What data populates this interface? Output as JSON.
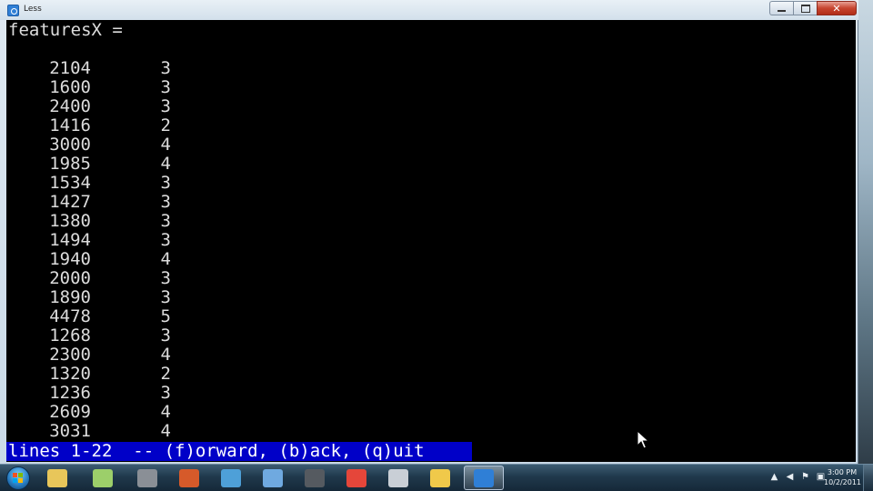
{
  "window": {
    "title": "Less"
  },
  "terminal": {
    "variable_line": "featuresX =",
    "rows": [
      {
        "col1": "2104",
        "col2": "3"
      },
      {
        "col1": "1600",
        "col2": "3"
      },
      {
        "col1": "2400",
        "col2": "3"
      },
      {
        "col1": "1416",
        "col2": "2"
      },
      {
        "col1": "3000",
        "col2": "4"
      },
      {
        "col1": "1985",
        "col2": "4"
      },
      {
        "col1": "1534",
        "col2": "3"
      },
      {
        "col1": "1427",
        "col2": "3"
      },
      {
        "col1": "1380",
        "col2": "3"
      },
      {
        "col1": "1494",
        "col2": "3"
      },
      {
        "col1": "1940",
        "col2": "4"
      },
      {
        "col1": "2000",
        "col2": "3"
      },
      {
        "col1": "1890",
        "col2": "3"
      },
      {
        "col1": "4478",
        "col2": "5"
      },
      {
        "col1": "1268",
        "col2": "3"
      },
      {
        "col1": "2300",
        "col2": "4"
      },
      {
        "col1": "1320",
        "col2": "2"
      },
      {
        "col1": "1236",
        "col2": "3"
      },
      {
        "col1": "2609",
        "col2": "4"
      },
      {
        "col1": "3031",
        "col2": "4"
      }
    ],
    "status": "lines 1-22  -- (f)orward, (b)ack, (q)uit"
  },
  "taskbar": {
    "buttons": [
      {
        "icon": "explorer-icon",
        "color": "#e8c65a",
        "active": false
      },
      {
        "icon": "notes-icon",
        "color": "#9ccf6a",
        "active": false
      },
      {
        "icon": "tools-icon",
        "color": "#8a8f96",
        "active": false
      },
      {
        "icon": "powerpoint-icon",
        "color": "#d65a2a",
        "active": false
      },
      {
        "icon": "remote-icon",
        "color": "#4ea0d8",
        "active": false
      },
      {
        "icon": "network-icon",
        "color": "#6fa9e0",
        "active": false
      },
      {
        "icon": "camera-icon",
        "color": "#555a60",
        "active": false
      },
      {
        "icon": "chrome-icon",
        "color": "#e5463a",
        "active": false
      },
      {
        "icon": "webcam-icon",
        "color": "#c9cfd6",
        "active": false
      },
      {
        "icon": "python-icon",
        "color": "#f0c94a",
        "active": false
      },
      {
        "icon": "octave-icon",
        "color": "#2f7fd6",
        "active": true
      }
    ],
    "clock_time": "3:00 PM",
    "clock_date": "10/2/2011"
  },
  "colors": {
    "terminal_bg": "#000000",
    "terminal_fg": "#dcdcdc",
    "status_bg": "#0000c8"
  }
}
